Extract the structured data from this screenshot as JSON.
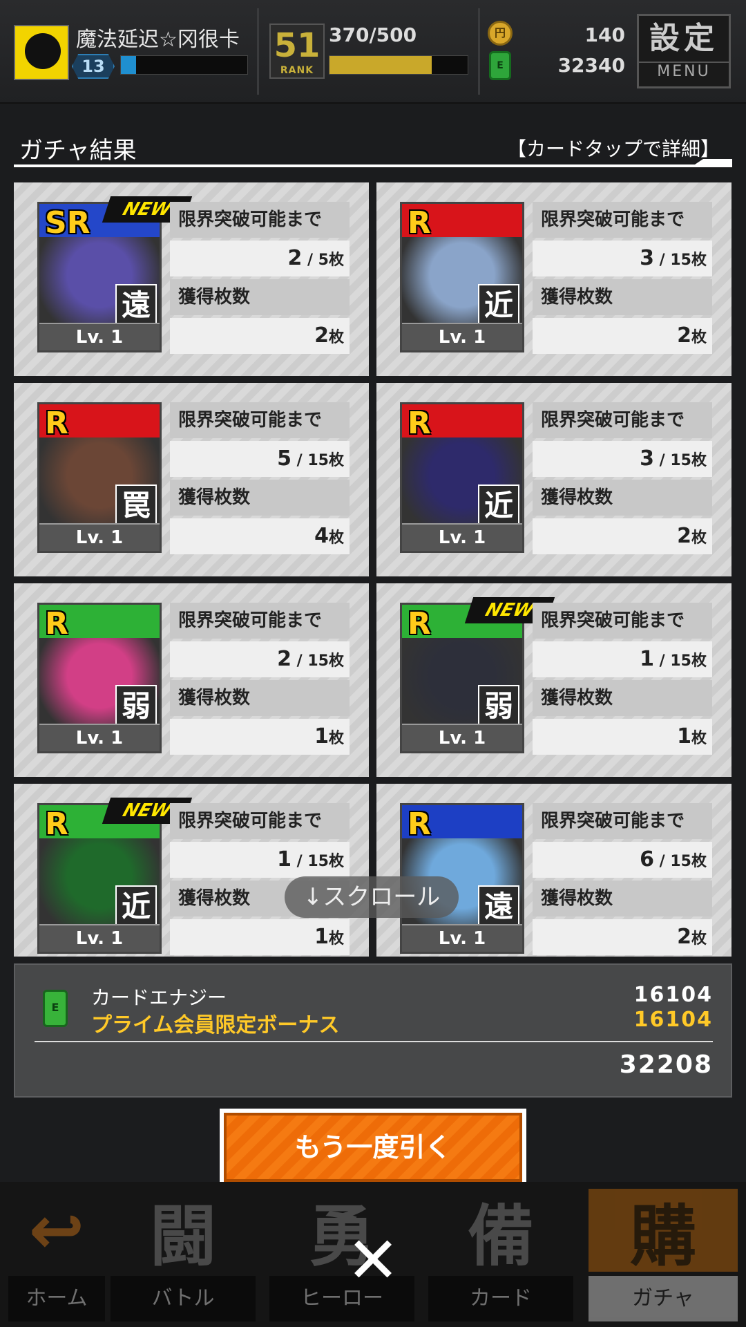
{
  "header": {
    "player_name": "魔法延迟☆冈很卡",
    "player_level": "13",
    "rank_value": "51",
    "rank_label": "RANK",
    "stamina": "370/500",
    "stamina_fraction": 0.74,
    "exp_fraction": 0.12,
    "coins": "140",
    "energy": "32340",
    "menu_label": "設定",
    "menu_sub": "MENU"
  },
  "page": {
    "title": "ガチャ結果",
    "hint": "【カードタップで詳細】"
  },
  "labels": {
    "limit": "限界突破可能まで",
    "owned": "獲得枚数",
    "unit": "枚",
    "lv": "Lv. 1",
    "new": "NEW"
  },
  "cards": [
    {
      "rarity": "SR",
      "type": "遠",
      "limit_now": "2",
      "limit_max": "5",
      "owned": "2",
      "new": true,
      "band": "#2447c9"
    },
    {
      "rarity": "R",
      "type": "近",
      "limit_now": "3",
      "limit_max": "15",
      "owned": "2",
      "new": false,
      "band": "#d8141a"
    },
    {
      "rarity": "R",
      "type": "罠",
      "limit_now": "5",
      "limit_max": "15",
      "owned": "4",
      "new": false,
      "band": "#d8141a"
    },
    {
      "rarity": "R",
      "type": "近",
      "limit_now": "3",
      "limit_max": "15",
      "owned": "2",
      "new": false,
      "band": "#d8141a"
    },
    {
      "rarity": "R",
      "type": "弱",
      "limit_now": "2",
      "limit_max": "15",
      "owned": "1",
      "new": false,
      "band": "#2db136"
    },
    {
      "rarity": "R",
      "type": "弱",
      "limit_now": "1",
      "limit_max": "15",
      "owned": "1",
      "new": true,
      "band": "#2db136"
    },
    {
      "rarity": "R",
      "type": "近",
      "limit_now": "1",
      "limit_max": "15",
      "owned": "1",
      "new": true,
      "band": "#2db136"
    },
    {
      "rarity": "R",
      "type": "遠",
      "limit_now": "6",
      "limit_max": "15",
      "owned": "2",
      "new": false,
      "band": "#1d3fc4"
    }
  ],
  "scroll_hint": "↓スクロール",
  "energy_panel": {
    "label": "カードエナジー",
    "bonus_label": "プライム会員限定ボーナス",
    "value": "16104",
    "bonus_value": "16104",
    "total": "32208"
  },
  "again_button": "もう一度引く",
  "nav": {
    "home": "ホーム",
    "battle": "バトル",
    "hero": "ヒーロー",
    "card": "カード",
    "gacha": "ガチャ",
    "battle_glyph": "闘",
    "hero_glyph": "勇",
    "card_glyph": "備",
    "gacha_glyph": "購"
  },
  "close_glyph": "✕",
  "colors": {
    "accent_orange": "#f57a12",
    "bonus_yellow": "#ffc928",
    "new_yellow": "#ffe600"
  }
}
